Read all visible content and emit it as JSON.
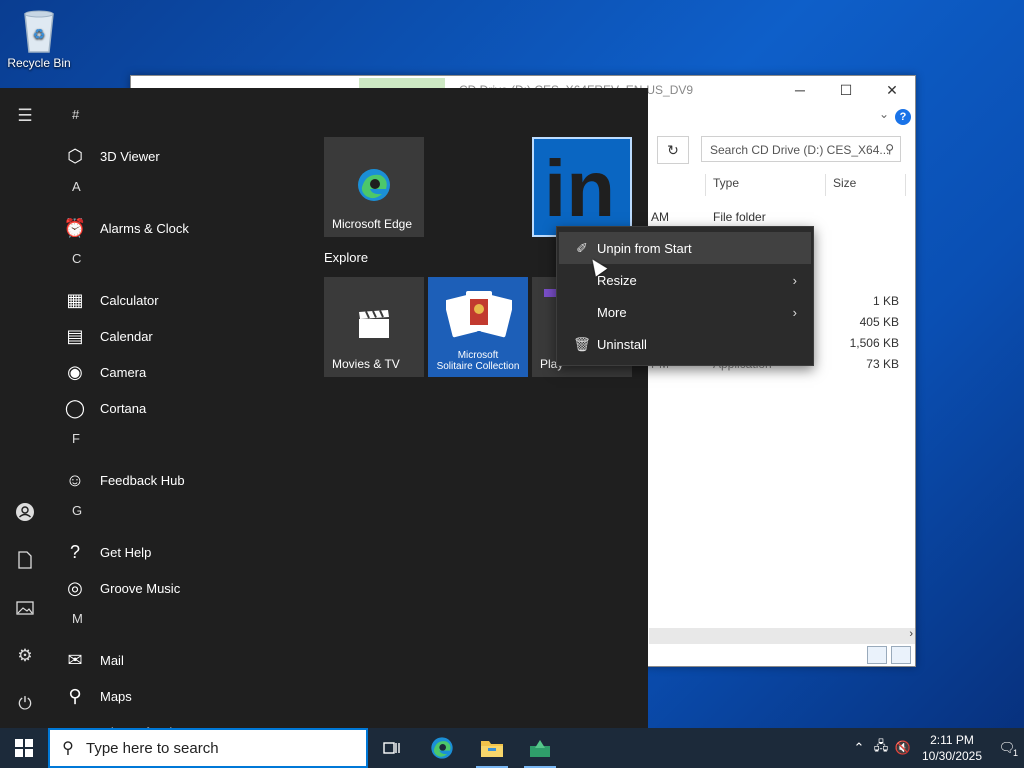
{
  "desktop": {
    "recycle_bin_label": "Recycle Bin"
  },
  "explorer": {
    "title": "CD Drive (D:) CES_X64FREV_EN-US_DV9",
    "search_placeholder": "Search CD Drive (D:) CES_X64...",
    "columns": {
      "type": "Type",
      "size": "Size"
    },
    "rows": [
      {
        "date_partial": "AM",
        "type": "File folder",
        "size": ""
      },
      {
        "date_partial": "",
        "type": "",
        "size": "1 KB"
      },
      {
        "date_partial": "",
        "type": "",
        "size": "405 KB"
      },
      {
        "date_partial": "",
        "type": "",
        "size": "1,506 KB"
      },
      {
        "date_partial": "PM",
        "type": "Application",
        "size": "73 KB"
      }
    ],
    "help_label": "?"
  },
  "start_menu": {
    "app_list": [
      {
        "kind": "letter",
        "text": "#"
      },
      {
        "kind": "app",
        "text": "3D Viewer",
        "icon": "cube-icon"
      },
      {
        "kind": "letter",
        "text": "A"
      },
      {
        "kind": "app",
        "text": "Alarms & Clock",
        "icon": "alarm-clock-icon"
      },
      {
        "kind": "letter",
        "text": "C"
      },
      {
        "kind": "app",
        "text": "Calculator",
        "icon": "calculator-icon"
      },
      {
        "kind": "app",
        "text": "Calendar",
        "icon": "calendar-icon"
      },
      {
        "kind": "app",
        "text": "Camera",
        "icon": "camera-icon"
      },
      {
        "kind": "app",
        "text": "Cortana",
        "icon": "cortana-icon"
      },
      {
        "kind": "letter",
        "text": "F"
      },
      {
        "kind": "app",
        "text": "Feedback Hub",
        "icon": "feedback-icon"
      },
      {
        "kind": "letter",
        "text": "G"
      },
      {
        "kind": "app",
        "text": "Get Help",
        "icon": "help-icon"
      },
      {
        "kind": "app",
        "text": "Groove Music",
        "icon": "music-icon"
      },
      {
        "kind": "letter",
        "text": "M"
      },
      {
        "kind": "app",
        "text": "Mail",
        "icon": "mail-icon"
      },
      {
        "kind": "app",
        "text": "Maps",
        "icon": "maps-icon"
      },
      {
        "kind": "app",
        "text": "Microsoft Edge",
        "icon": "edge-icon"
      }
    ],
    "tiles": {
      "edge": "Microsoft Edge",
      "explore_group": "Explore",
      "movies": "Movies & TV",
      "solitaire_line1": "Microsoft",
      "solitaire_line2": "Solitaire Collection",
      "play": "Play",
      "linkedin_logo": "in"
    }
  },
  "context_menu": {
    "items": [
      {
        "label": "Unpin from Start",
        "icon": "unpin-icon",
        "submenu": false
      },
      {
        "label": "Resize",
        "icon": "",
        "submenu": true
      },
      {
        "label": "More",
        "icon": "",
        "submenu": true
      },
      {
        "label": "Uninstall",
        "icon": "trash-icon",
        "submenu": false
      }
    ]
  },
  "taskbar": {
    "search_placeholder": "Type here to search",
    "time": "2:11 PM",
    "date": "10/30/2025",
    "notification_count": "1"
  },
  "colors": {
    "accent": "#0078d7",
    "start_bg": "#1f1f1f",
    "linkedin": "#0a66c2"
  }
}
